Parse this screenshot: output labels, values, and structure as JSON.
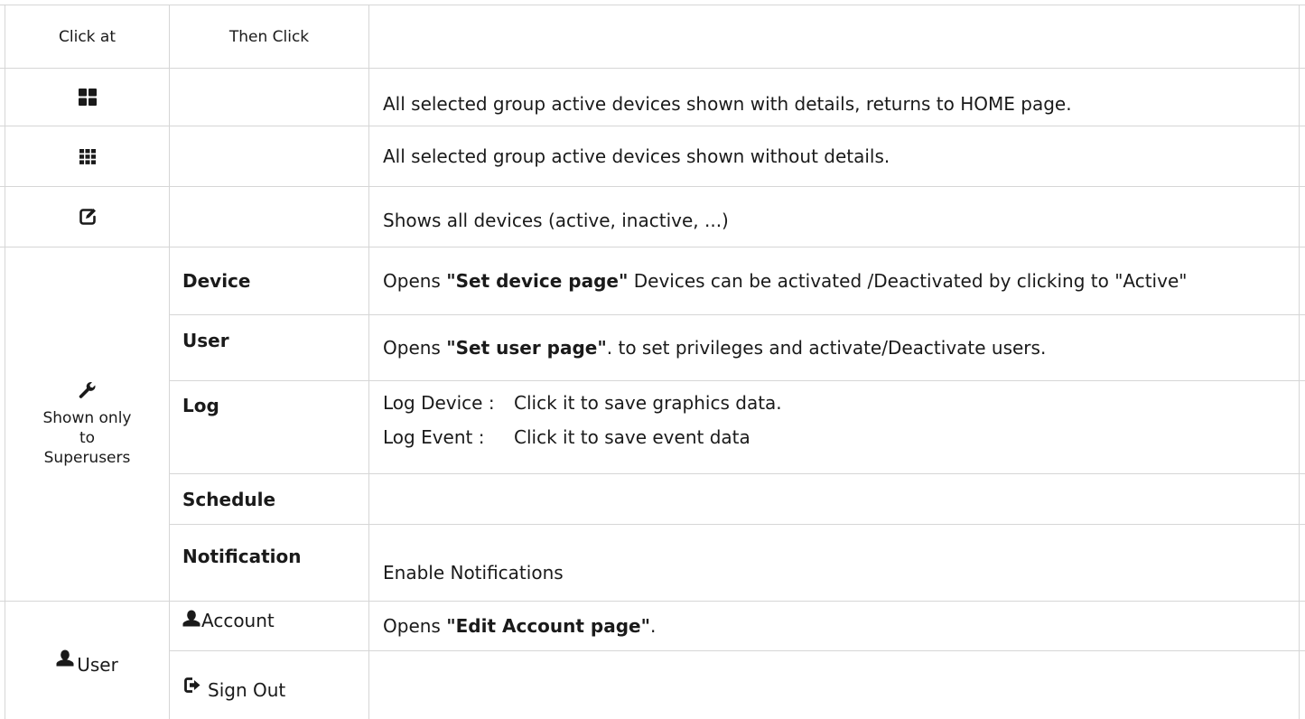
{
  "header": {
    "col1": "Click at",
    "col2": "Then Click",
    "col3": ""
  },
  "rows": {
    "grid_large": {
      "icon": "grid-large-icon",
      "desc": "All selected group active devices shown with details, returns to HOME page."
    },
    "grid_small": {
      "icon": "grid-small-icon",
      "desc": "All selected group active devices shown without details."
    },
    "edit": {
      "icon": "edit-icon",
      "desc": "Shows all devices (active, inactive, ...)"
    },
    "wrench": {
      "icon": "wrench-icon",
      "label": "Shown only to Superusers",
      "device": {
        "name": "Device",
        "desc_pre": "Opens ",
        "desc_bold": "\"Set device page\"",
        "desc_post": " Devices can be  activated /Deactivated by clicking to  \"Active\""
      },
      "user": {
        "name": "User",
        "desc_pre": "Opens ",
        "desc_bold": "\"Set user page\"",
        "desc_post": ". to set privileges and activate/Deactivate users."
      },
      "log": {
        "name": "Log",
        "line1_label": "Log Device :",
        "line1_text": "Click it to save graphics data.",
        "line2_label": "Log Event :",
        "line2_text": "Click it to save event data"
      },
      "schedule": {
        "name": "Schedule",
        "desc": ""
      },
      "notification": {
        "name": "Notification",
        "desc": "Enable  Notifications"
      }
    },
    "user": {
      "icon": "user-icon",
      "label": "User",
      "account": {
        "icon": "user-icon",
        "name": "Account",
        "desc_pre": "Opens ",
        "desc_bold": "\"Edit Account page\"",
        "desc_post": "."
      },
      "signout": {
        "icon": "sign-out-icon",
        "name": "Sign Out",
        "desc": ""
      }
    }
  },
  "colors": {
    "grid_line": "#d6d6d6",
    "text": "#1a1a1a",
    "icon": "#1a1a1a"
  }
}
